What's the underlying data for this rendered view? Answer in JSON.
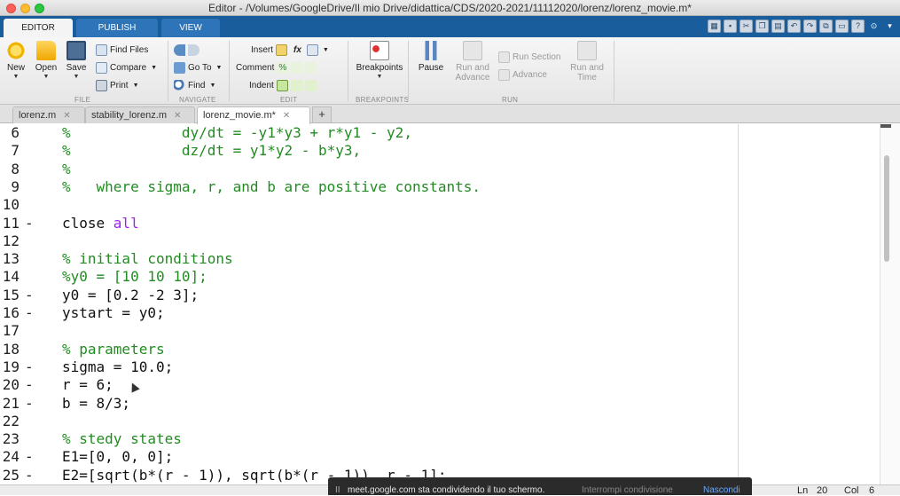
{
  "window": {
    "title": "Editor - /Volumes/GoogleDrive/Il mio Drive/didattica/CDS/2020-2021/11112020/lorenz/lorenz_movie.m*"
  },
  "ribbon_tabs": [
    "EDITOR",
    "PUBLISH",
    "VIEW"
  ],
  "ribbon": {
    "file": {
      "label": "FILE",
      "new": "New",
      "open": "Open",
      "save": "Save",
      "find_files": "Find Files",
      "compare": "Compare",
      "print": "Print"
    },
    "navigate": {
      "label": "NAVIGATE",
      "go_to": "Go To",
      "find": "Find"
    },
    "edit": {
      "label": "EDIT",
      "insert": "Insert",
      "comment": "Comment",
      "indent": "Indent",
      "fx": "fx"
    },
    "breakpoints": {
      "label": "BREAKPOINTS",
      "breakpoints": "Breakpoints"
    },
    "run": {
      "label": "RUN",
      "pause": "Pause",
      "run_and_advance_1": "Run and",
      "run_and_advance_2": "Advance",
      "run_section": "Run Section",
      "advance": "Advance",
      "run_and_time_1": "Run and",
      "run_and_time_2": "Time"
    }
  },
  "doc_tabs": [
    {
      "label": "lorenz.m"
    },
    {
      "label": "stability_lorenz.m"
    },
    {
      "label": "lorenz_movie.m*"
    }
  ],
  "code_lines": [
    {
      "n": "6",
      "dash": "",
      "text": "%             dy/dt = -y1*y3 + r*y1 - y2,",
      "kind": "comment"
    },
    {
      "n": "7",
      "dash": "",
      "text": "%             dz/dt = y1*y2 - b*y3,",
      "kind": "comment"
    },
    {
      "n": "8",
      "dash": "",
      "text": "%",
      "kind": "comment"
    },
    {
      "n": "9",
      "dash": "",
      "text": "%   where sigma, r, and b are positive constants.",
      "kind": "comment"
    },
    {
      "n": "10",
      "dash": "",
      "text": "",
      "kind": "code"
    },
    {
      "n": "11",
      "dash": "-",
      "text_a": "close ",
      "text_b": "all",
      "kind": "kw"
    },
    {
      "n": "12",
      "dash": "",
      "text": "",
      "kind": "code"
    },
    {
      "n": "13",
      "dash": "",
      "text": "% initial conditions",
      "kind": "comment"
    },
    {
      "n": "14",
      "dash": "",
      "text": "%y0 = [10 10 10];",
      "kind": "comment"
    },
    {
      "n": "15",
      "dash": "-",
      "text": "y0 = [0.2 -2 3];",
      "kind": "code"
    },
    {
      "n": "16",
      "dash": "-",
      "text": "ystart = y0;",
      "kind": "code"
    },
    {
      "n": "17",
      "dash": "",
      "text": "",
      "kind": "code"
    },
    {
      "n": "18",
      "dash": "",
      "text": "% parameters",
      "kind": "comment"
    },
    {
      "n": "19",
      "dash": "-",
      "text": "sigma = 10.0;",
      "kind": "code"
    },
    {
      "n": "20",
      "dash": "-",
      "text": "r = 6;",
      "kind": "code"
    },
    {
      "n": "21",
      "dash": "-",
      "text": "b = 8/3;",
      "kind": "code"
    },
    {
      "n": "22",
      "dash": "",
      "text": "",
      "kind": "code"
    },
    {
      "n": "23",
      "dash": "",
      "text": "% stedy states",
      "kind": "comment"
    },
    {
      "n": "24",
      "dash": "-",
      "text": "E1=[0, 0, 0];",
      "kind": "code"
    },
    {
      "n": "25",
      "dash": "-",
      "text": "E2=[sqrt(b*(r - 1)), sqrt(b*(r - 1)), r - 1];",
      "kind": "code"
    }
  ],
  "status": {
    "ln_label": "Ln",
    "ln": "20",
    "col_label": "Col",
    "col": "6"
  },
  "share_banner": {
    "pause_glyph": "II",
    "message": "meet.google.com sta condividendo il tuo schermo.",
    "stop": "Interrompi condivisione",
    "hide": "Nascondi"
  }
}
